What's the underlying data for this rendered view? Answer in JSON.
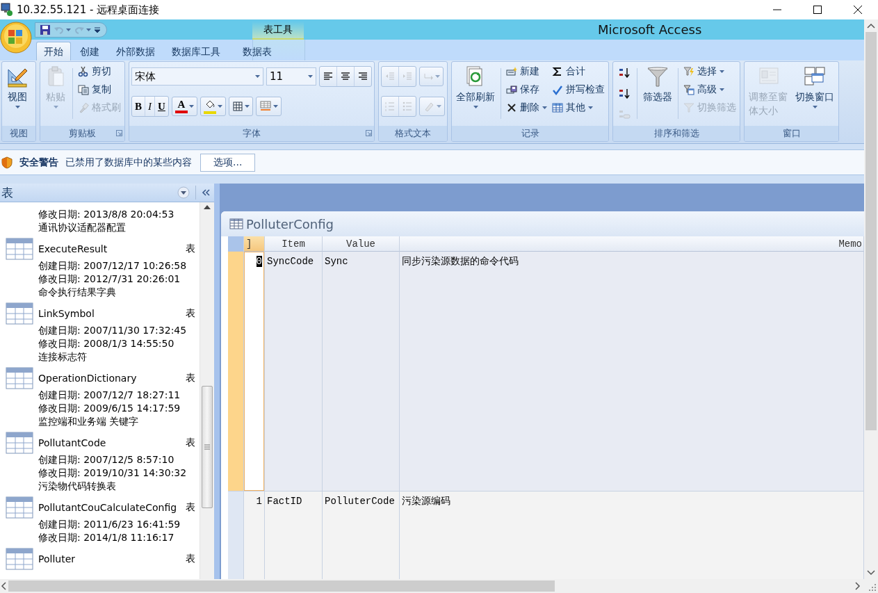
{
  "remote_window": {
    "title": "10.32.55.121 - 远程桌面连接"
  },
  "app": {
    "title": "Microsoft Access",
    "context_group": "表工具"
  },
  "quick_access": [
    {
      "disabled": false,
      "dropdown": false
    },
    {
      "disabled": true,
      "dropdown": true
    },
    {
      "disabled": true,
      "dropdown": true
    }
  ],
  "ribbon_tabs": [
    {
      "label": "开始",
      "selected": true,
      "kind": "standard"
    },
    {
      "label": "创建",
      "selected": false,
      "kind": "standard"
    },
    {
      "label": "外部数据",
      "selected": false,
      "kind": "standard"
    },
    {
      "label": "数据库工具",
      "selected": false,
      "kind": "standard"
    },
    {
      "label": "数据表",
      "selected": false,
      "kind": "contextual"
    }
  ],
  "ribbon_groups": [
    {
      "label": "视图",
      "launcher": false,
      "columns": [
        [
          {
            "kind": "large",
            "label": "视图",
            "dropdown": true,
            "disabled": false
          }
        ]
      ]
    },
    {
      "label": "剪贴板",
      "launcher": true,
      "columns": [
        [
          {
            "kind": "large",
            "label": "粘贴",
            "dropdown": true,
            "disabled": true
          }
        ],
        [
          {
            "kind": "small",
            "label": "剪切",
            "dropdown": false,
            "disabled": false
          },
          {
            "kind": "small",
            "label": "复制",
            "dropdown": false,
            "disabled": false
          },
          {
            "kind": "small",
            "label": "格式刷",
            "dropdown": false,
            "disabled": true
          }
        ]
      ]
    },
    {
      "label": "字体",
      "launcher": true,
      "columns": [
        [
          {
            "kind": "line",
            "items": [
              {
                "kind": "combo",
                "value": "宋体"
              },
              {
                "kind": "combo",
                "value": "11"
              },
              {
                "kind": "strip",
                "items": [
                  {
                    "kind": "icon",
                    "dropdown": false,
                    "disabled": false
                  },
                  {
                    "kind": "icon",
                    "dropdown": false,
                    "disabled": false
                  },
                  {
                    "kind": "icon",
                    "dropdown": false,
                    "disabled": false
                  }
                ]
              }
            ]
          },
          {
            "kind": "line",
            "items": [
              {
                "kind": "strip",
                "items": [
                  {
                    "kind": "glyph",
                    "label": "B",
                    "dropdown": false,
                    "disabled": false
                  },
                  {
                    "kind": "glyph",
                    "label": "I",
                    "dropdown": false,
                    "disabled": false
                  },
                  {
                    "kind": "glyph",
                    "label": "U",
                    "dropdown": false,
                    "disabled": false
                  }
                ]
              },
              {
                "kind": "glyph",
                "label": "A",
                "color": "#e00000",
                "dropdown": true,
                "disabled": false
              },
              {
                "kind": "icon",
                "color": "#e8d800",
                "dropdown": true,
                "disabled": false
              },
              {
                "kind": "icon",
                "dropdown": true,
                "disabled": false
              },
              {
                "kind": "icon",
                "dropdown": true,
                "disabled": false
              }
            ]
          }
        ]
      ]
    },
    {
      "label": "格式文本",
      "launcher": false,
      "columns": [
        [
          {
            "kind": "line",
            "items": [
              {
                "kind": "strip",
                "items": [
                  {
                    "kind": "icon",
                    "dropdown": false,
                    "disabled": true
                  },
                  {
                    "kind": "icon",
                    "dropdown": false,
                    "disabled": true
                  }
                ]
              },
              {
                "kind": "icon",
                "dropdown": true,
                "disabled": true
              }
            ]
          },
          {
            "kind": "line",
            "items": [
              {
                "kind": "strip",
                "items": [
                  {
                    "kind": "icon",
                    "dropdown": false,
                    "disabled": true
                  },
                  {
                    "kind": "icon",
                    "dropdown": false,
                    "disabled": true
                  }
                ]
              },
              {
                "kind": "icon",
                "dropdown": true,
                "disabled": true
              }
            ]
          }
        ]
      ]
    },
    {
      "label": "记录",
      "launcher": false,
      "columns": [
        [
          {
            "kind": "large",
            "label": "全部刷新",
            "dropdown": true,
            "disabled": false
          }
        ],
        [
          {
            "kind": "small",
            "label": "新建",
            "dropdown": false,
            "disabled": false
          },
          {
            "kind": "small",
            "label": "保存",
            "dropdown": false,
            "disabled": false
          },
          {
            "kind": "small",
            "label": "删除",
            "dropdown": true,
            "disabled": false
          }
        ],
        [
          {
            "kind": "small",
            "label": "合计",
            "dropdown": false,
            "disabled": false
          },
          {
            "kind": "small",
            "label": "拼写检查",
            "dropdown": false,
            "disabled": false
          },
          {
            "kind": "small",
            "label": "其他",
            "dropdown": true,
            "disabled": false
          }
        ]
      ]
    },
    {
      "label": "排序和筛选",
      "launcher": false,
      "columns": [
        [
          {
            "kind": "icon",
            "dropdown": false,
            "disabled": false
          },
          {
            "kind": "icon",
            "dropdown": false,
            "disabled": false
          },
          {
            "kind": "icon",
            "dropdown": false,
            "disabled": true
          }
        ],
        [
          {
            "kind": "large",
            "label": "筛选器",
            "dropdown": false,
            "disabled": false
          }
        ],
        [
          {
            "kind": "small",
            "label": "选择",
            "dropdown": true,
            "disabled": false
          },
          {
            "kind": "small",
            "label": "高级",
            "dropdown": true,
            "disabled": false
          },
          {
            "kind": "small",
            "label": "切换筛选",
            "dropdown": false,
            "disabled": true
          }
        ]
      ]
    },
    {
      "label": "窗口",
      "launcher": false,
      "columns": [
        [
          {
            "kind": "large",
            "label": "调整至窗体大小",
            "dropdown": false,
            "disabled": true
          }
        ],
        [
          {
            "kind": "large",
            "label": "切换窗口",
            "dropdown": true,
            "disabled": false
          }
        ]
      ]
    }
  ],
  "security_bar": {
    "title": "安全警告",
    "message": "已禁用了数据库中的某些内容",
    "button": "选项..."
  },
  "nav_pane": {
    "title": "表",
    "items": [
      {
        "modified": "修改日期: 2013/8/8 20:04:53",
        "description": "通讯协议适配器配置"
      },
      {
        "name": "ExecuteResult",
        "type": "表",
        "created": "创建日期: 2007/12/17 10:26:58",
        "modified": "修改日期: 2012/7/31 20:26:01",
        "description": "命令执行结果字典"
      },
      {
        "name": "LinkSymbol",
        "type": "表",
        "created": "创建日期: 2007/11/30 17:32:45",
        "modified": "修改日期: 2008/1/3 14:55:50",
        "description": "连接标志符"
      },
      {
        "name": "OperationDictionary",
        "type": "表",
        "created": "创建日期: 2007/12/7 18:27:11",
        "modified": "修改日期: 2009/6/15 14:17:59",
        "description": "监控端和业务端 关键字"
      },
      {
        "name": "PollutantCode",
        "type": "表",
        "created": "创建日期: 2007/12/5 8:57:10",
        "modified": "修改日期: 2019/10/31 14:30:32",
        "description": "污染物代码转换表"
      },
      {
        "name": "PollutantCouCalculateConfig",
        "type": "表",
        "created": "创建日期: 2011/6/23 16:41:59",
        "modified": "修改日期: 2014/1/8 11:16:17"
      },
      {
        "name": "Polluter",
        "type": "表"
      }
    ]
  },
  "document": {
    "title": "PolluterConfig",
    "columns": [
      "]",
      "Item",
      "Value",
      "Memo"
    ],
    "rows": [
      {
        "selected": true,
        "cells": [
          "0",
          "SyncCode",
          "Sync",
          "同步污染源数据的命令代码"
        ]
      },
      {
        "selected": false,
        "cells": [
          "1",
          "FactID",
          "PolluterCode",
          "污染源编码"
        ]
      }
    ]
  }
}
